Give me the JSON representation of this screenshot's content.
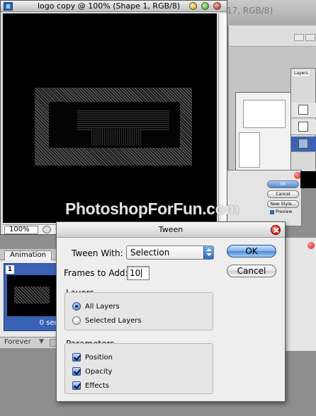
{
  "document": {
    "title": "logo copy @ 100% (Shape 1, RGB/8)",
    "zoom": "100%"
  },
  "background": {
    "window_title_fragment": "17, RGB/8)",
    "layers_tab": "Layers",
    "layer_style_buttons": [
      "OK",
      "Cancel",
      "New Style..."
    ],
    "preview_label": "Preview"
  },
  "watermark": "PhotoshopForFun.com",
  "animation": {
    "tab_label": "Animation",
    "frame_number": "1",
    "frame_delay": "0 sec",
    "loop": "Forever"
  },
  "tween_dialog": {
    "title": "Tween",
    "tween_with_label": "Tween With:",
    "tween_with_value": "Selection",
    "frames_label": "Frames to Add:",
    "frames_value": "10",
    "ok_label": "OK",
    "cancel_label": "Cancel",
    "layers": {
      "title": "Layers",
      "options": [
        {
          "label": "All Layers",
          "selected": true
        },
        {
          "label": "Selected Layers",
          "selected": false
        }
      ]
    },
    "parameters": {
      "title": "Parameters",
      "options": [
        {
          "label": "Position",
          "checked": true
        },
        {
          "label": "Opacity",
          "checked": true
        },
        {
          "label": "Effects",
          "checked": true
        }
      ]
    }
  },
  "colors": {
    "accent_blue": "#3a73cc",
    "canvas_black": "#000000",
    "close_red": "#d41f14"
  }
}
